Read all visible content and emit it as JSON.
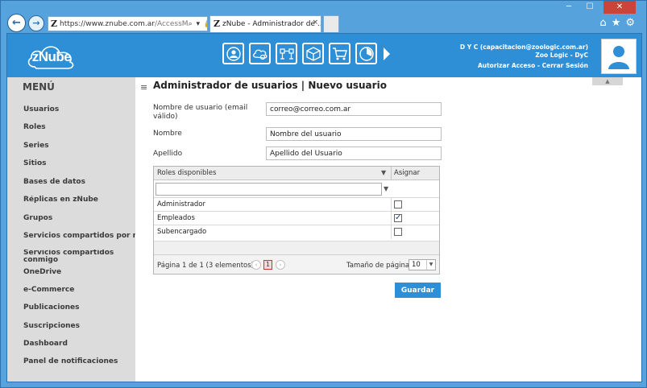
{
  "browser": {
    "url_main": "https://www.znube.com.ar",
    "url_rest": "/AccessM",
    "address_tools": "⌕ ▾ 🔒 ↻",
    "tab_title": "zNube - Administrador de ...",
    "tab_close": "×"
  },
  "header": {
    "logo_text": "zNube",
    "user_name": "D Y C (capacitacion@zoologic.com.ar)",
    "company": "Zoo Logic - DyC",
    "authorize_access": "Autorizar Acceso",
    "link_separator": "-",
    "logout": "Cerrar Sesión"
  },
  "sidebar": {
    "title": "MENÚ",
    "items": [
      "Usuarios",
      "Roles",
      "Series",
      "Sitios",
      "Bases de datos",
      "Réplicas en zNube",
      "Grupos",
      "Servicios compartidos por mi",
      "Servicios compartidos conmigo",
      "OneDrive",
      "e-Commerce",
      "Publicaciones",
      "Suscripciones",
      "Dashboard",
      "Panel de notificaciones"
    ]
  },
  "main": {
    "collapse": "▲",
    "hamburger": "≡",
    "title": "Administrador de usuarios | Nuevo usuario",
    "fields": {
      "username_label_1": "Nombre de usuario (email",
      "username_label_2": "válido)",
      "username_value": "correo@correo.com.ar",
      "name_label": "Nombre",
      "name_value": "Nombre del usuario",
      "lastname_label": "Apellido",
      "lastname_value": "Apellido del Usuario"
    },
    "grid": {
      "col_roles": "Roles disponibles",
      "col_assign": "Asignar",
      "rows": [
        {
          "name": "Administrador",
          "checked": false
        },
        {
          "name": "Empleados",
          "checked": true
        },
        {
          "name": "Subencargado",
          "checked": false
        }
      ],
      "page_info": "Página 1 de 1 (3 elementos)",
      "current_page": "1",
      "prev": "‹",
      "next": "›",
      "page_size_label": "Tamaño de página:",
      "page_size": "10"
    },
    "save_label": "Guardar"
  }
}
